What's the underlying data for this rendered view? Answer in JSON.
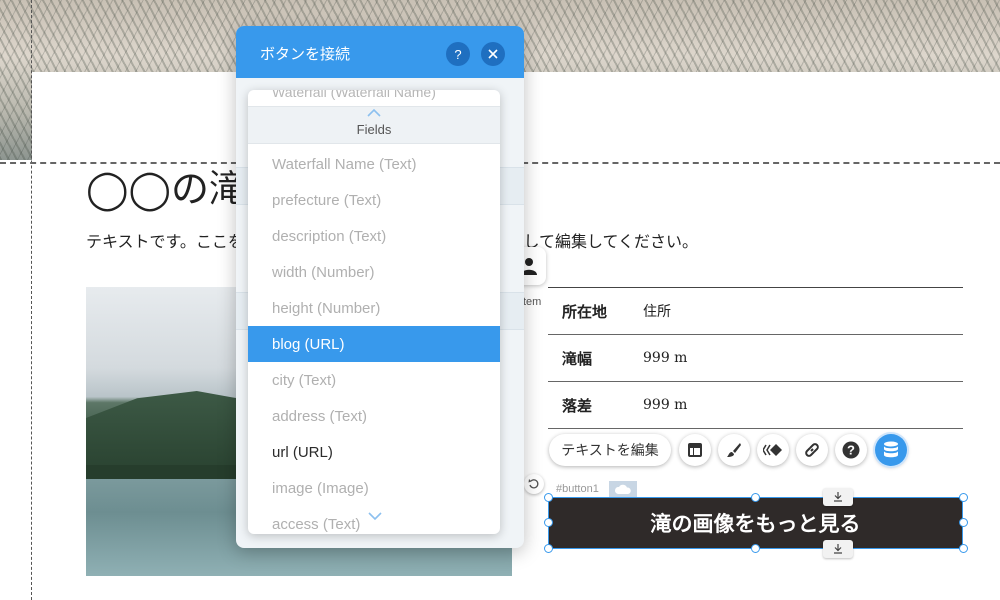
{
  "page": {
    "title": "◯◯の滝",
    "body_text": "テキストです。ここをクリックし、「テキストを編集」を選択して編集してください。"
  },
  "info_table": [
    {
      "label": "所在地",
      "value": "住所"
    },
    {
      "label": "滝幅",
      "value": "999 m"
    },
    {
      "label": "落差",
      "value": "999 m"
    }
  ],
  "repeater": {
    "caption": "ll Item",
    "icon": "repeater-item-icon"
  },
  "toolbar": {
    "edit_text_label": "テキストを編集",
    "buttons": [
      "layout-icon",
      "design-brush-icon",
      "animation-icon",
      "link-icon",
      "help-icon",
      "database-connect-icon"
    ]
  },
  "selected_element": {
    "tag": "#button1",
    "label": "滝の画像をもっと見る"
  },
  "dialog": {
    "title": "ボタンを接続",
    "help_label": "?",
    "close_label": "×"
  },
  "dropdown": {
    "previous_item": "Waterfall (Waterfall Name)",
    "section_label": "Fields",
    "items": [
      {
        "label": "Waterfall Name (Text)",
        "state": "disabled"
      },
      {
        "label": "prefecture (Text)",
        "state": "disabled"
      },
      {
        "label": "description (Text)",
        "state": "disabled"
      },
      {
        "label": "width (Number)",
        "state": "disabled"
      },
      {
        "label": "height (Number)",
        "state": "disabled"
      },
      {
        "label": "blog (URL)",
        "state": "selected"
      },
      {
        "label": "city (Text)",
        "state": "disabled"
      },
      {
        "label": "address (Text)",
        "state": "disabled"
      },
      {
        "label": "url (URL)",
        "state": "enabled"
      },
      {
        "label": "image (Image)",
        "state": "disabled"
      },
      {
        "label": "access (Text)",
        "state": "disabled"
      }
    ]
  },
  "colors": {
    "accent": "#3899ec",
    "cta_background": "#2f2a29"
  }
}
